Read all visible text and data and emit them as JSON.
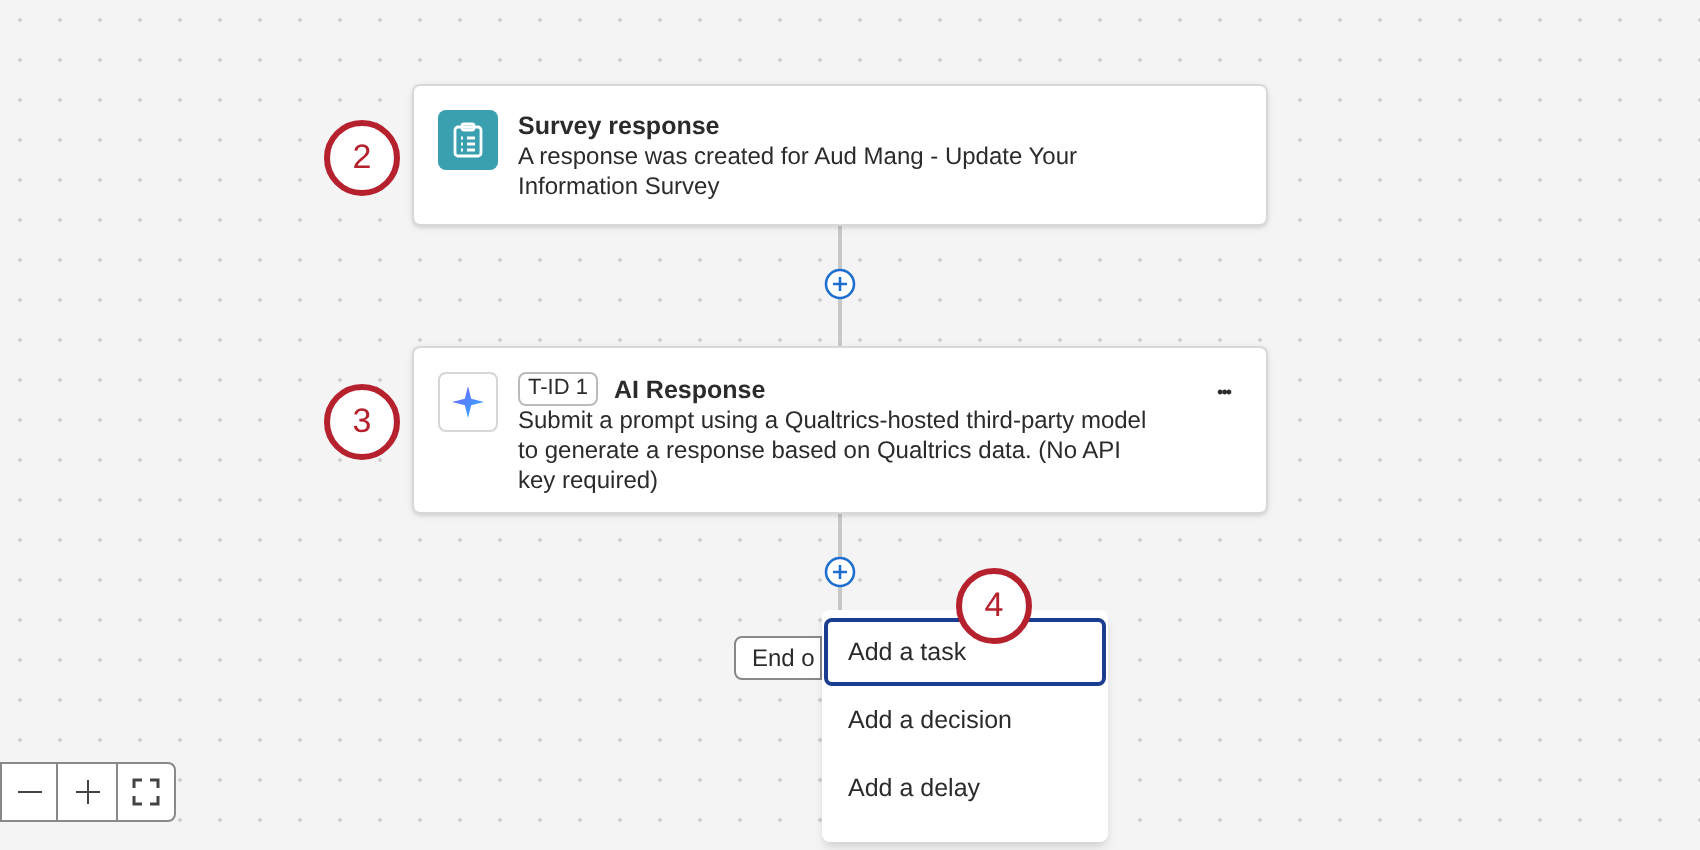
{
  "nodes": [
    {
      "kind": "trigger",
      "title": "Survey response",
      "description": "A response was created for Aud Mang - Update Your Information Survey"
    },
    {
      "kind": "task",
      "tag": "T-ID 1",
      "title": "AI Response",
      "description": "Submit a prompt using a Qualtrics-hosted third-party model to generate a response based on Qualtrics data. (No API key required)",
      "more": "•••"
    }
  ],
  "callouts": [
    "2",
    "3",
    "4"
  ],
  "end_button": "End o",
  "menu": [
    {
      "label": "Add a task",
      "selected": true
    },
    {
      "label": "Add a decision",
      "selected": false
    },
    {
      "label": "Add a delay",
      "selected": false
    }
  ]
}
